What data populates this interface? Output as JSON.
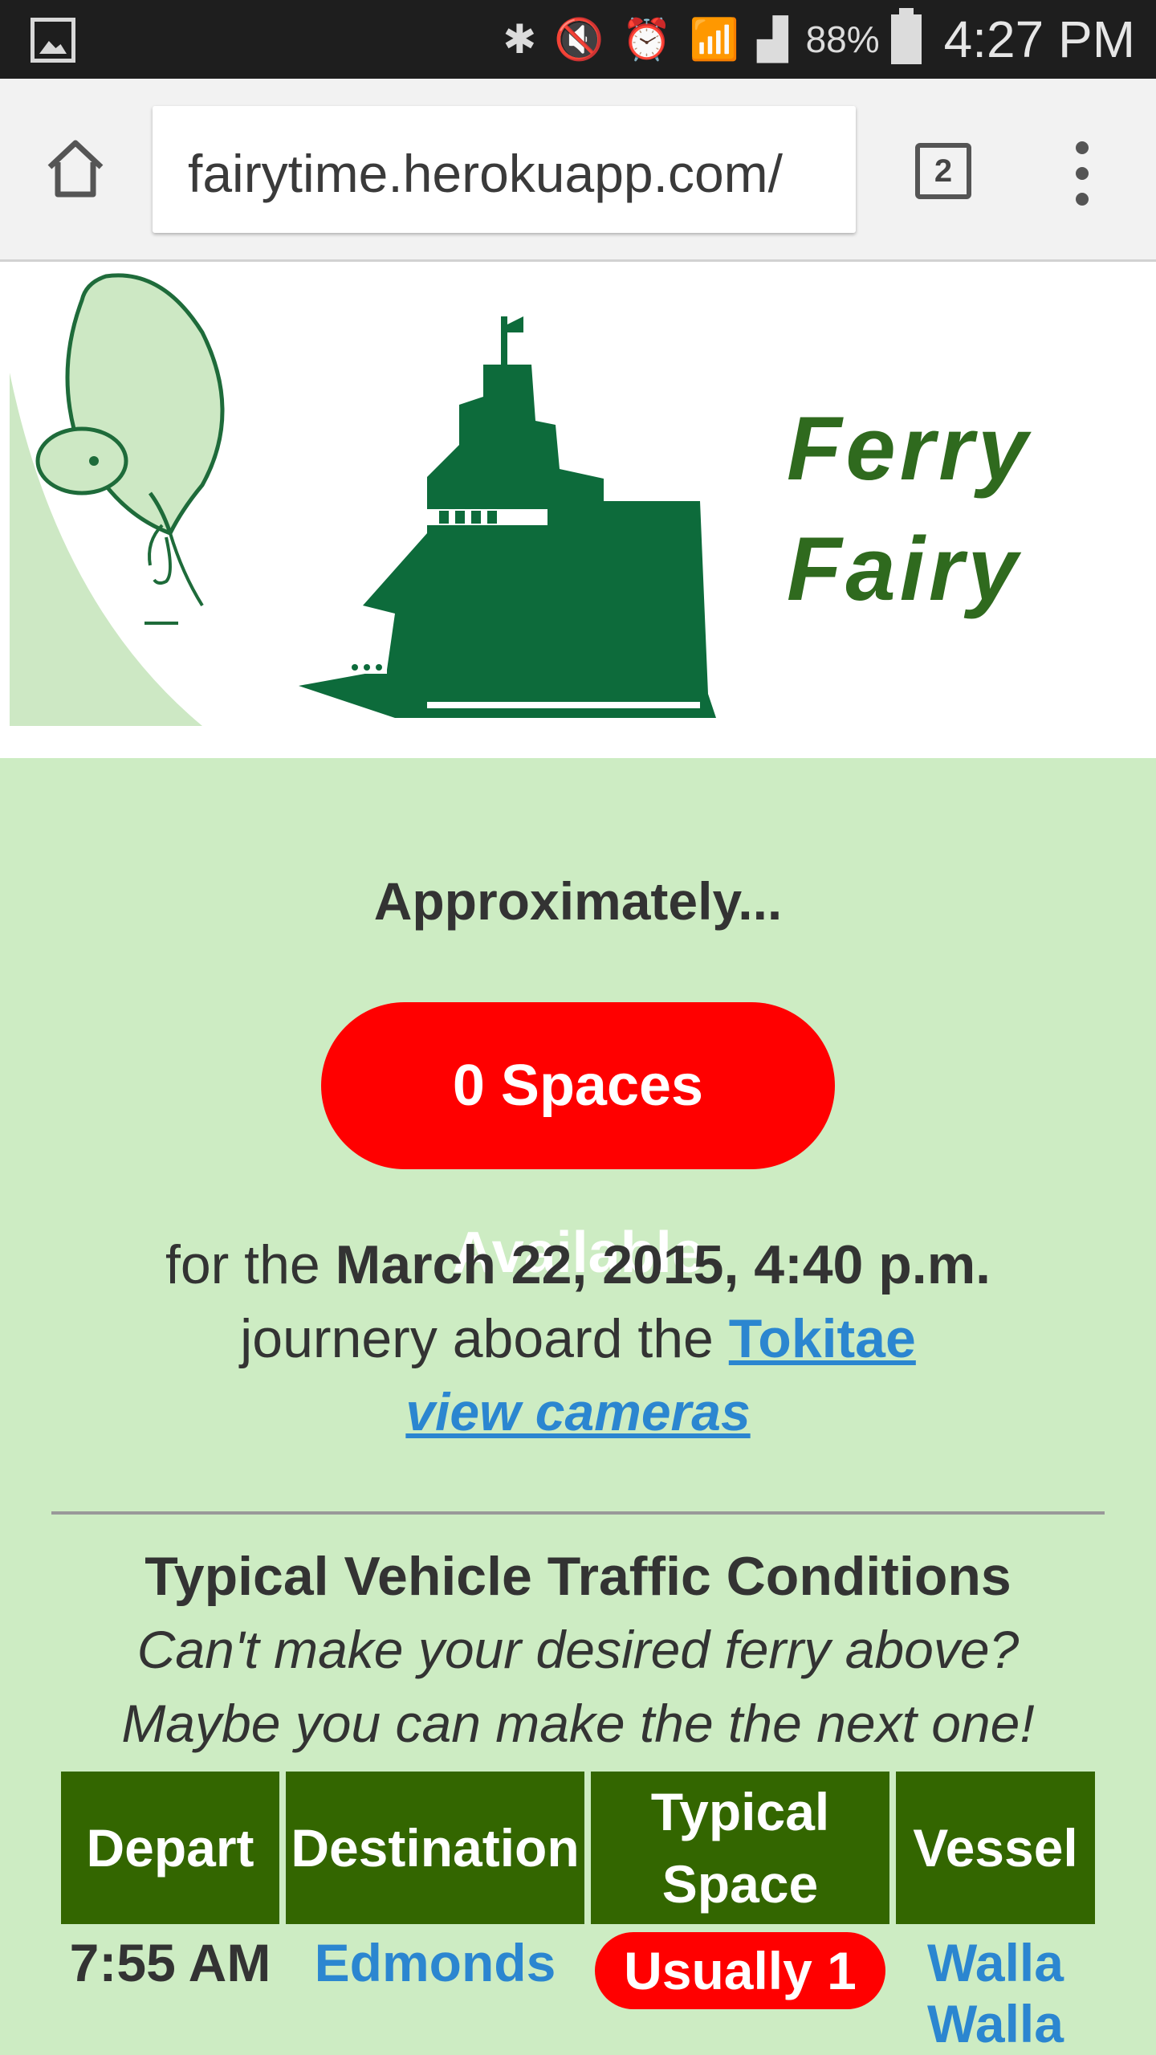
{
  "status_bar": {
    "battery_percent": "88%",
    "time": "4:27 PM",
    "icons": [
      "gallery-icon",
      "bluetooth-icon",
      "mute-icon",
      "alarm-icon",
      "wifi-icon",
      "signal-icon",
      "battery-icon"
    ]
  },
  "browser": {
    "url": "fairytime.herokuapp.com/",
    "tab_count": "2"
  },
  "banner": {
    "brand_line1": "Ferry",
    "brand_line2": "Fairy"
  },
  "availability": {
    "approx_label": "Approximately...",
    "spaces_label": "0 Spaces Available",
    "for_prefix": "for the",
    "sailing_datetime": "March 22, 2015, 4:40 p.m.",
    "journey_prefix": "journery aboard the",
    "vessel_name": "Tokitae",
    "cameras_link": "view cameras"
  },
  "traffic": {
    "title": "Typical Vehicle Traffic Conditions",
    "subtitle_line1": "Can't make your desired ferry above?",
    "subtitle_line2": "Maybe you can make the the next one!",
    "columns": [
      "Depart",
      "Destination",
      "Typical Space",
      "Vessel"
    ],
    "rows": [
      {
        "depart": "7:55 AM",
        "destination": "Edmonds",
        "space": "Usually 1",
        "vessel": "Walla Walla"
      }
    ]
  },
  "colors": {
    "page_bg": "#cdecc3",
    "brand_green": "#2f6a1e",
    "header_green": "#336600",
    "alert_red": "#ff0000",
    "link_blue": "#2b86d0"
  }
}
